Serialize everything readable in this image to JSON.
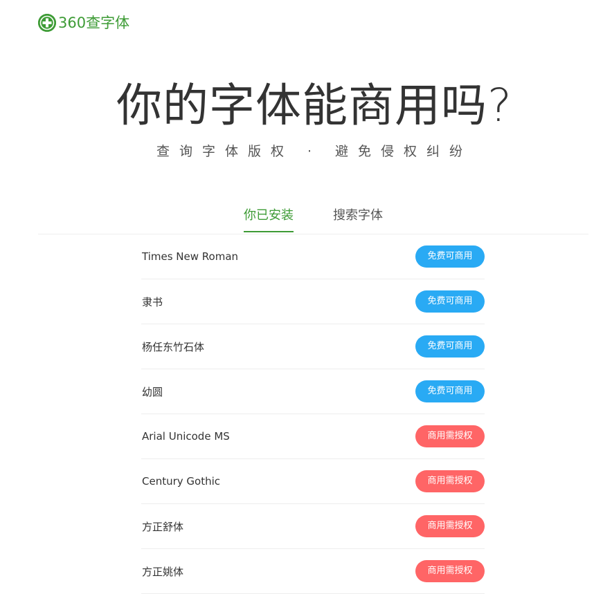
{
  "colors": {
    "brand": "#3d9b35",
    "free_badge": "#29aaf4",
    "license_badge": "#ff6566"
  },
  "logo": {
    "icon": "plus-circle-icon",
    "text": "360查字体"
  },
  "hero": {
    "title": "你的字体能商用吗?",
    "subtitle": "查询字体版权 · 避免侵权纠纷"
  },
  "tabs": [
    {
      "label": "你已安装",
      "active": true
    },
    {
      "label": "搜索字体",
      "active": false
    }
  ],
  "fonts": [
    {
      "name": "Times New Roman",
      "status": "免费可商用",
      "type": "free"
    },
    {
      "name": "隶书",
      "status": "免费可商用",
      "type": "free"
    },
    {
      "name": "杨任东竹石体",
      "status": "免费可商用",
      "type": "free"
    },
    {
      "name": "幼圆",
      "status": "免费可商用",
      "type": "free"
    },
    {
      "name": "Arial Unicode MS",
      "status": "商用需授权",
      "type": "license"
    },
    {
      "name": "Century Gothic",
      "status": "商用需授权",
      "type": "license"
    },
    {
      "name": "方正舒体",
      "status": "商用需授权",
      "type": "license"
    },
    {
      "name": "方正姚体",
      "status": "商用需授权",
      "type": "license"
    }
  ]
}
